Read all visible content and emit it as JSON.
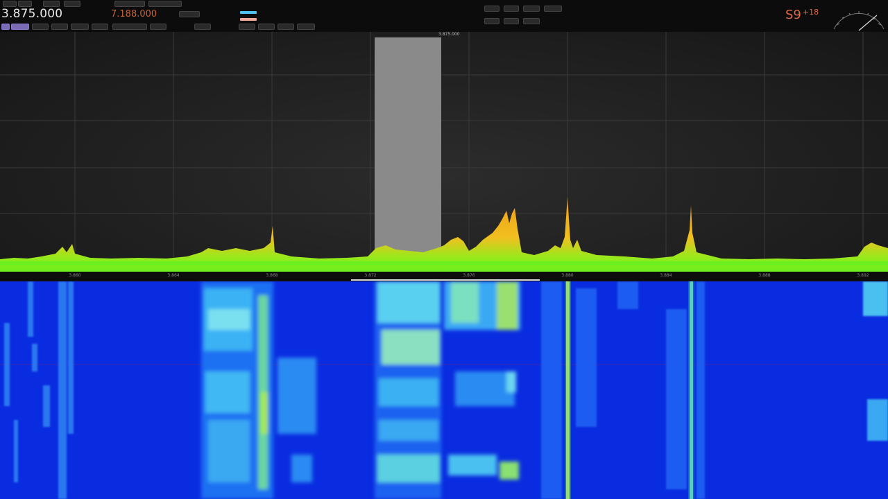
{
  "header": {
    "vfo_a": "3.875.000",
    "vfo_b": "7.188.000",
    "smeter": {
      "unit": "S9",
      "over": "+18"
    }
  },
  "spectrum": {
    "tune_marker": "3.875.000",
    "scale_ticks": [
      "3.860",
      "3.864",
      "3.868",
      "3.872",
      "3.876",
      "3.880",
      "3.884",
      "3.888",
      "3.892"
    ],
    "colors": {
      "peak": "#f5a020",
      "floor": "#7cf01e",
      "passband": "#8a8a8a"
    }
  },
  "waterfall": {
    "background": "#0a2ce0"
  }
}
